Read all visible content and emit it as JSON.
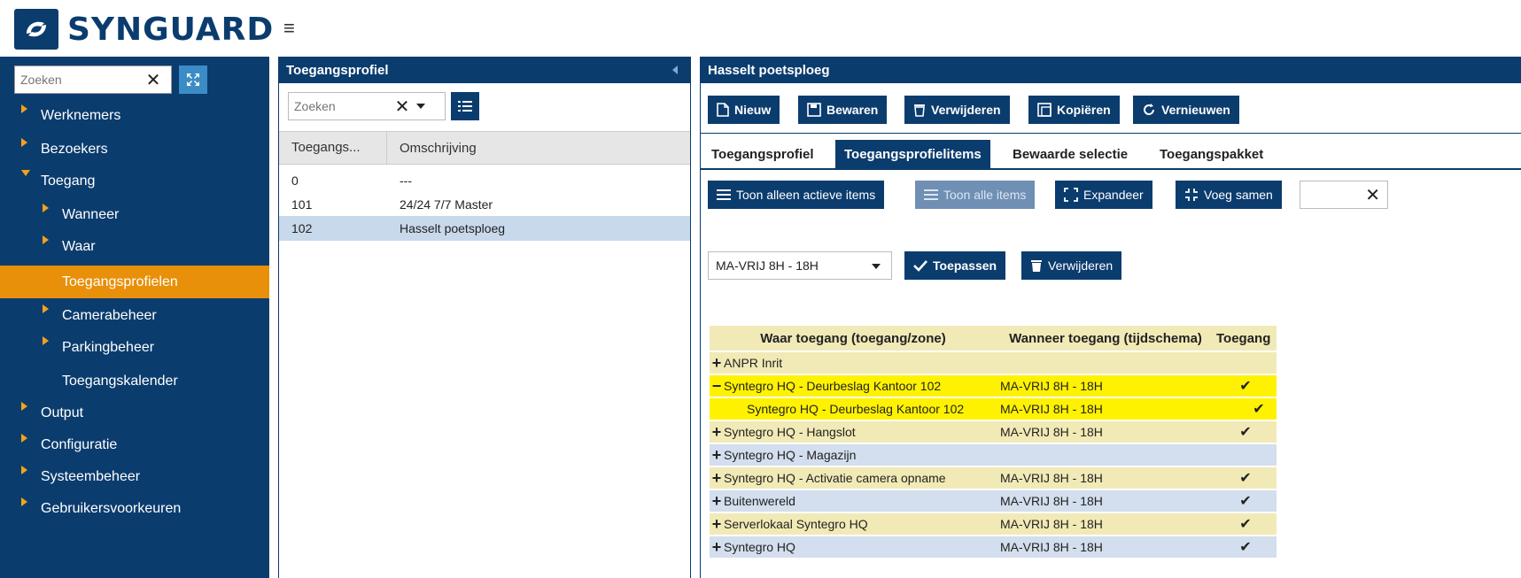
{
  "app": {
    "brand": "SYNGUARD"
  },
  "sidebar": {
    "search_placeholder": "Zoeken",
    "items": [
      {
        "label": "Werknemers",
        "level": 0,
        "arrow": "right"
      },
      {
        "label": "Bezoekers",
        "level": 0,
        "arrow": "right"
      },
      {
        "label": "Toegang",
        "level": 0,
        "arrow": "down"
      },
      {
        "label": "Wanneer",
        "level": 1,
        "arrow": "right"
      },
      {
        "label": "Waar",
        "level": 1,
        "arrow": "right"
      },
      {
        "label": "Toegangsprofielen",
        "level": 1,
        "arrow": "none",
        "active": true
      },
      {
        "label": "Camerabeheer",
        "level": 1,
        "arrow": "right"
      },
      {
        "label": "Parkingbeheer",
        "level": 1,
        "arrow": "right"
      },
      {
        "label": "Toegangskalender",
        "level": 1,
        "arrow": "none"
      },
      {
        "label": "Output",
        "level": 0,
        "arrow": "right"
      },
      {
        "label": "Configuratie",
        "level": 0,
        "arrow": "right"
      },
      {
        "label": "Systeembeheer",
        "level": 0,
        "arrow": "right"
      },
      {
        "label": "Gebruikersvoorkeuren",
        "level": 0,
        "arrow": "right"
      }
    ]
  },
  "profiles_panel": {
    "title": "Toegangsprofiel",
    "search_placeholder": "Zoeken",
    "columns": [
      "Toegangs...",
      "Omschrijving"
    ],
    "rows": [
      {
        "id": "0",
        "desc": "---"
      },
      {
        "id": "101",
        "desc": "24/24 7/7 Master"
      },
      {
        "id": "102",
        "desc": "Hasselt poetsploeg",
        "selected": true
      }
    ]
  },
  "detail_panel": {
    "title": "Hasselt poetsploeg",
    "toolbar": {
      "new": "Nieuw",
      "save": "Bewaren",
      "delete": "Verwijderen",
      "copy": "Kopiëren",
      "refresh": "Vernieuwen"
    },
    "tabs": [
      "Toegangsprofiel",
      "Toegangsprofielitems",
      "Bewaarde selectie",
      "Toegangspakket"
    ],
    "active_tab": "Toegangsprofielitems",
    "filters": {
      "active_only": "Toon alleen actieve items",
      "show_all": "Toon alle items",
      "expand": "Expandeer",
      "merge": "Voeg samen"
    },
    "schedule": {
      "selected": "MA-VRIJ 8H - 18H",
      "apply": "Toepassen",
      "remove": "Verwijderen"
    },
    "grid": {
      "headers": [
        "Waar toegang (toegang/zone)",
        "Wanneer toegang (tijdschema)",
        "Toegang"
      ],
      "rows": [
        {
          "toggle": "+",
          "where": "ANPR Inrit",
          "when": "",
          "access": false,
          "style": "y"
        },
        {
          "toggle": "−",
          "where": "Syntegro HQ - Deurbeslag Kantoor 102",
          "when": "MA-VRIJ 8H - 18H",
          "access": true,
          "style": "hi"
        },
        {
          "toggle": "",
          "where": "Syntegro HQ - Deurbeslag Kantoor 102",
          "when": "MA-VRIJ 8H - 18H",
          "access": true,
          "style": "hi",
          "child": true
        },
        {
          "toggle": "+",
          "where": "Syntegro HQ - Hangslot",
          "when": "MA-VRIJ 8H - 18H",
          "access": true,
          "style": "y"
        },
        {
          "toggle": "+",
          "where": "Syntegro HQ - Magazijn",
          "when": "",
          "access": false,
          "style": "b"
        },
        {
          "toggle": "+",
          "where": "Syntegro HQ - Activatie camera opname",
          "when": "MA-VRIJ 8H - 18H",
          "access": true,
          "style": "y"
        },
        {
          "toggle": "+",
          "where": "Buitenwereld",
          "when": "MA-VRIJ 8H - 18H",
          "access": true,
          "style": "b"
        },
        {
          "toggle": "+",
          "where": "Serverlokaal Syntegro HQ",
          "when": "MA-VRIJ 8H - 18H",
          "access": true,
          "style": "y"
        },
        {
          "toggle": "+",
          "where": "Syntegro HQ",
          "when": "MA-VRIJ 8H - 18H",
          "access": true,
          "style": "b"
        }
      ]
    }
  },
  "colors": {
    "brand": "#0b3c6e",
    "active": "#e8900a",
    "highlight": "#fff200"
  }
}
